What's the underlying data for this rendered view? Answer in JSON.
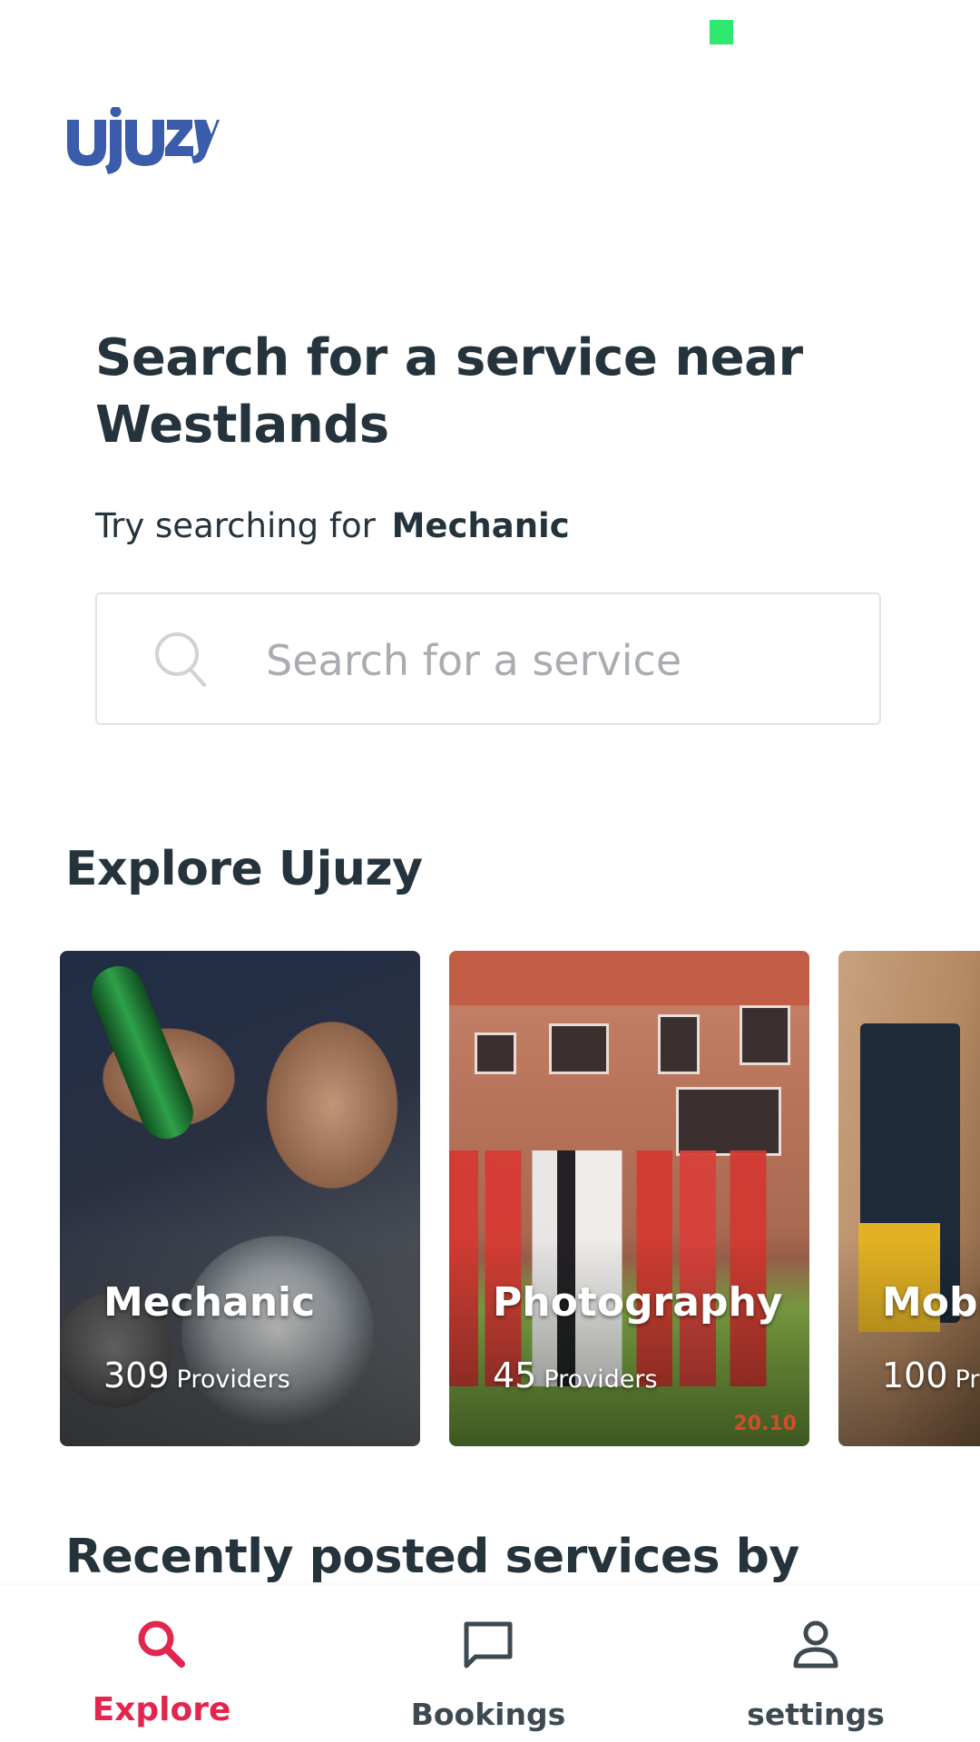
{
  "app": {
    "logo_text": "ujuzy"
  },
  "colors": {
    "brand_blue": "#3b5bab",
    "accent": "#e2264d",
    "text": "#24333c",
    "status_dot": "#2ee86f"
  },
  "hero": {
    "title": "Search for a service near Westlands",
    "try_prefix": "Try searching for",
    "try_keyword": "Mechanic"
  },
  "search": {
    "placeholder": "Search for a service",
    "value": "",
    "icon": "search-icon"
  },
  "explore": {
    "title": "Explore Ujuzy",
    "cards": [
      {
        "title": "Mechanic",
        "count": "309",
        "count_label": "Providers"
      },
      {
        "title": "Photography",
        "count": "45",
        "count_label": "Providers",
        "photo_stamp": "20.10"
      },
      {
        "title": "Mobi",
        "count": "100",
        "count_label": "Pr"
      }
    ]
  },
  "recent": {
    "title": "Recently posted services by"
  },
  "nav": {
    "items": [
      {
        "label": "Explore",
        "icon": "search-icon",
        "active": true
      },
      {
        "label": "Bookings",
        "icon": "chat-icon",
        "active": false
      },
      {
        "label": "settings",
        "icon": "person-icon",
        "active": false
      }
    ]
  }
}
